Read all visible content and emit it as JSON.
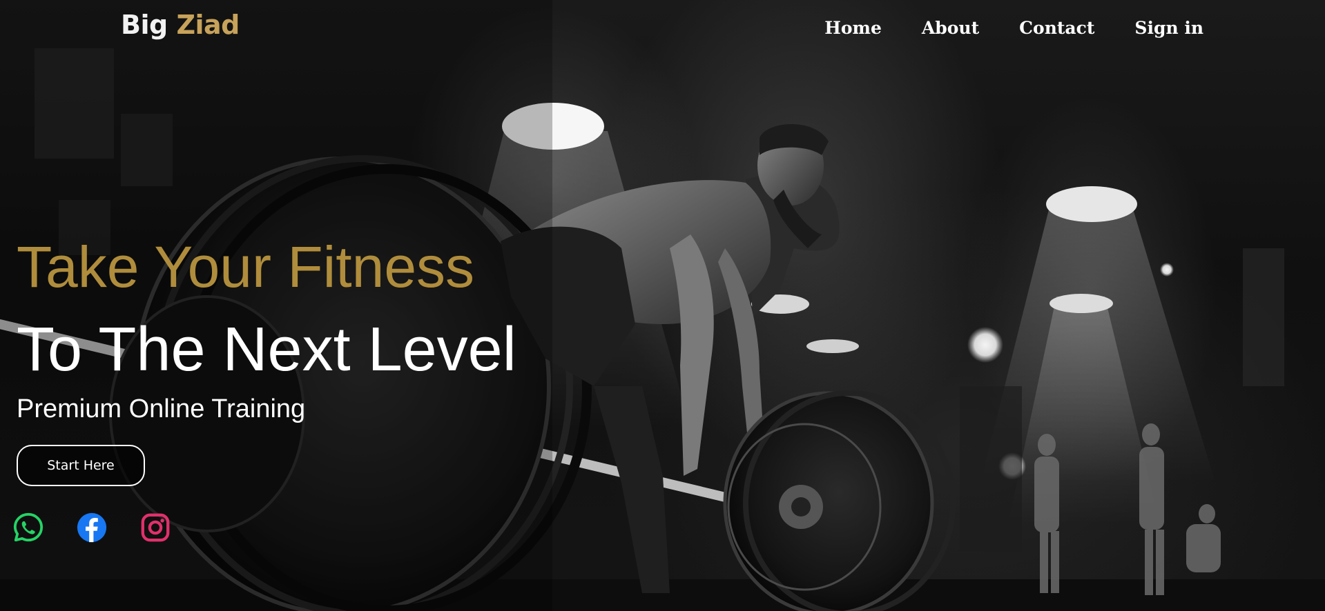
{
  "brand": {
    "part1": "Big",
    "part2": "Ziad"
  },
  "nav": {
    "items": [
      {
        "label": "Home"
      },
      {
        "label": "About"
      },
      {
        "label": "Contact"
      },
      {
        "label": "Sign in"
      }
    ]
  },
  "hero": {
    "headline_line1": "Take Your Fitness",
    "headline_line2": "To The Next Level",
    "subheadline": "Premium Online Training",
    "cta_label": "Start Here",
    "background_image": "black-and-white gym photo of man performing barbell deadlift"
  },
  "socials": [
    {
      "icon": "whatsapp-icon",
      "color": "#25d366"
    },
    {
      "icon": "facebook-icon",
      "color": "#1877f2"
    },
    {
      "icon": "instagram-icon",
      "color": "#e1306c"
    }
  ],
  "colors": {
    "accent_gold": "#b08d3c",
    "brand_gold": "#c7a25a",
    "text_white": "#ffffff"
  }
}
